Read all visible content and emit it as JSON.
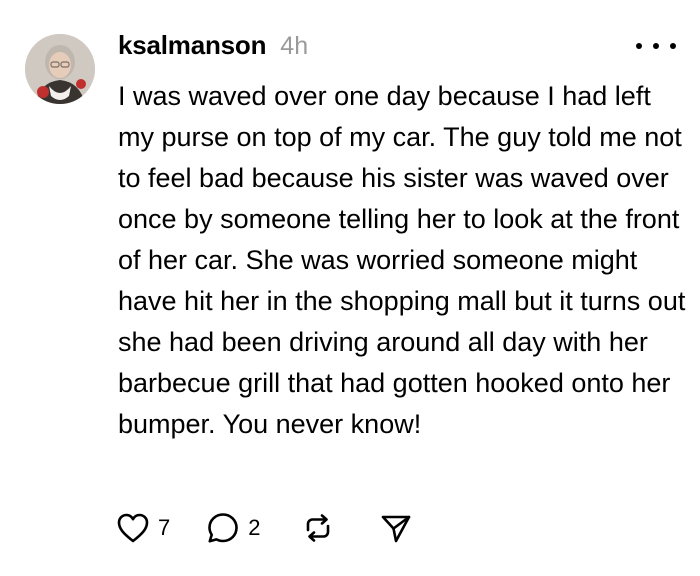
{
  "post": {
    "username": "ksalmanson",
    "timestamp": "4h",
    "body": "I was waved over one day because I had left my purse on top of my car. The guy told me not to feel bad because his sister was waved over once by someone telling her to look at the front of her car. She was worried someone might have hit her in the shopping mall but it turns out she had been driving around all day with her barbecue grill that had gotten hooked onto her bumper. You never know!",
    "actions": {
      "like_count": "7",
      "reply_count": "2",
      "like_icon": "heart-icon",
      "reply_icon": "comment-bubble-icon",
      "repost_icon": "repost-icon",
      "share_icon": "send-icon",
      "more_icon": "more-dots-icon"
    }
  }
}
